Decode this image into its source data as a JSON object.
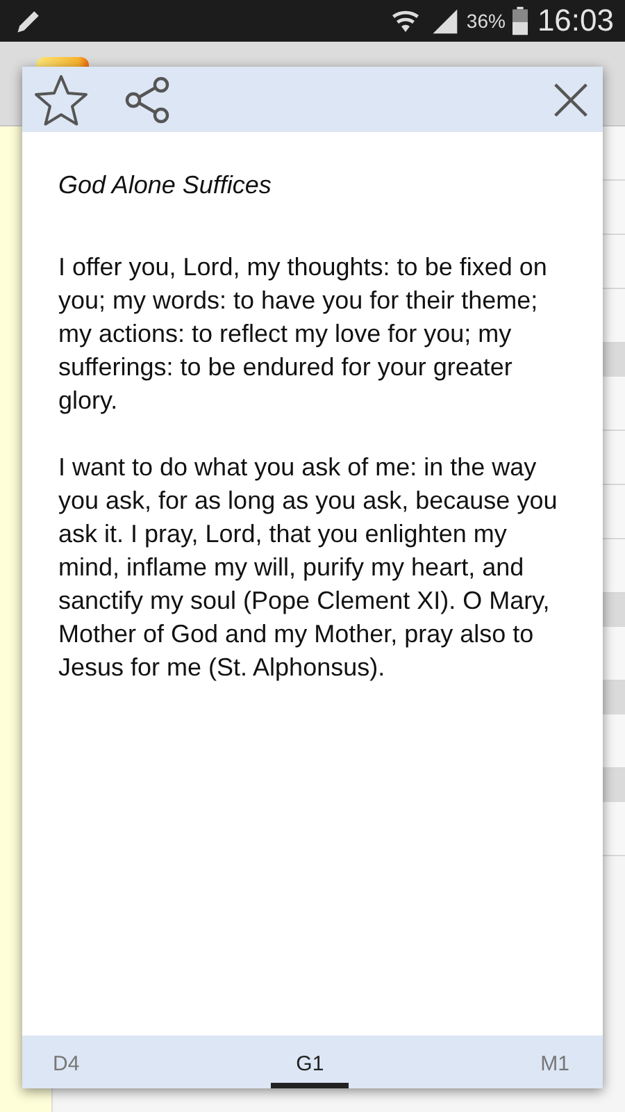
{
  "status_bar": {
    "battery": "36%",
    "time": "16:03"
  },
  "dialog": {
    "title": "God Alone Suffices",
    "paragraphs": [
      "I offer you, Lord, my thoughts: to be fixed on you; my words: to have you for their theme; my actions: to reflect my love for you; my sufferings: to be endured for your greater glory.",
      "I want to do what you ask of me: in the way you ask, for as long as you ask, because you ask it. I pray, Lord, that you enlighten my mind, inflame my will, purify my heart, and sanctify my soul (Pope Clement XI). O Mary, Mother of God and my Mother, pray also to Jesus for me (St. Alphonsus)."
    ],
    "tabs": [
      {
        "label": "D4",
        "selected": false
      },
      {
        "label": "G1",
        "selected": true
      },
      {
        "label": "M1",
        "selected": false
      }
    ]
  }
}
